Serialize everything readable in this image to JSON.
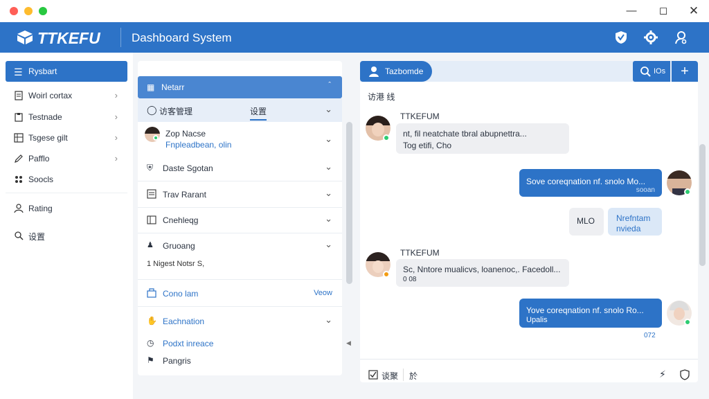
{
  "app": {
    "brand": "TTKEFU",
    "title": "Dashboard System"
  },
  "sidebar": {
    "active": "Rysbart",
    "items": [
      {
        "label": "Woirl cortax",
        "icon": "document-icon"
      },
      {
        "label": "Testnade",
        "icon": "clipboard-icon"
      },
      {
        "label": "Tsgese gilt",
        "icon": "grid-doc-icon"
      },
      {
        "label": "Pafflo",
        "icon": "pencil-icon"
      },
      {
        "label": "Soocls",
        "icon": "group-icon"
      },
      {
        "label": "Rating",
        "icon": "user-icon"
      },
      {
        "label": "设置",
        "icon": "search-settings-icon"
      }
    ]
  },
  "midpanel": {
    "active": "Netarr",
    "sub_label": "访客管理",
    "sub_tab": "设置",
    "contact_name": "Zop Nacse",
    "contact_link": "Fnpleadbean, olin",
    "items": [
      {
        "label": "Daste Sgotan",
        "icon": "shield-icon"
      },
      {
        "label": "Trav Rarant",
        "icon": "list-icon"
      },
      {
        "label": "Cnehleqg",
        "icon": "calendar-icon"
      },
      {
        "label": "Gruoang",
        "icon": "people-icon"
      }
    ],
    "note": "1 Nigest Notsr S,",
    "link_item": "Cono lam",
    "link_action": "Veow",
    "bottom_items": [
      {
        "label": "Eachnation",
        "icon": "hand-icon"
      },
      {
        "label": "Podxt inreace",
        "icon": "clock-icon"
      },
      {
        "label": "Pangris",
        "icon": "flag-icon"
      }
    ]
  },
  "chat": {
    "tab": "Tazbomde",
    "search_label": "IOs",
    "subheader": "访港 线",
    "messages": [
      {
        "dir": "in",
        "sender": "TTKEFUM",
        "line1": "nt, fil neatchate tbral abupnettra...",
        "line2": "Tog etifi, Cho"
      },
      {
        "dir": "out",
        "line1": "Sove coreqnation nf. snolo Mo...",
        "line2": "sooan"
      },
      {
        "dir": "in-small",
        "line1": "MLO"
      },
      {
        "dir": "out-small",
        "line1": "Nrefntam",
        "line2": "nvieda"
      },
      {
        "dir": "in",
        "sender": "TTKEFUM",
        "line1": "Sc, Nntore mualicvs, loanenoc,. Facedoll...",
        "line2": "0 08"
      },
      {
        "dir": "out",
        "line1": "Yove coreqnation nf. snolo Ro...",
        "line2": "Upalis",
        "meta": "072"
      }
    ],
    "footer_action": "谈聚",
    "footer_extra": "於"
  },
  "colors": {
    "primary": "#2d73c7",
    "primary_light": "#4a86d1",
    "online": "#2ecc71",
    "away": "#f39c12"
  }
}
